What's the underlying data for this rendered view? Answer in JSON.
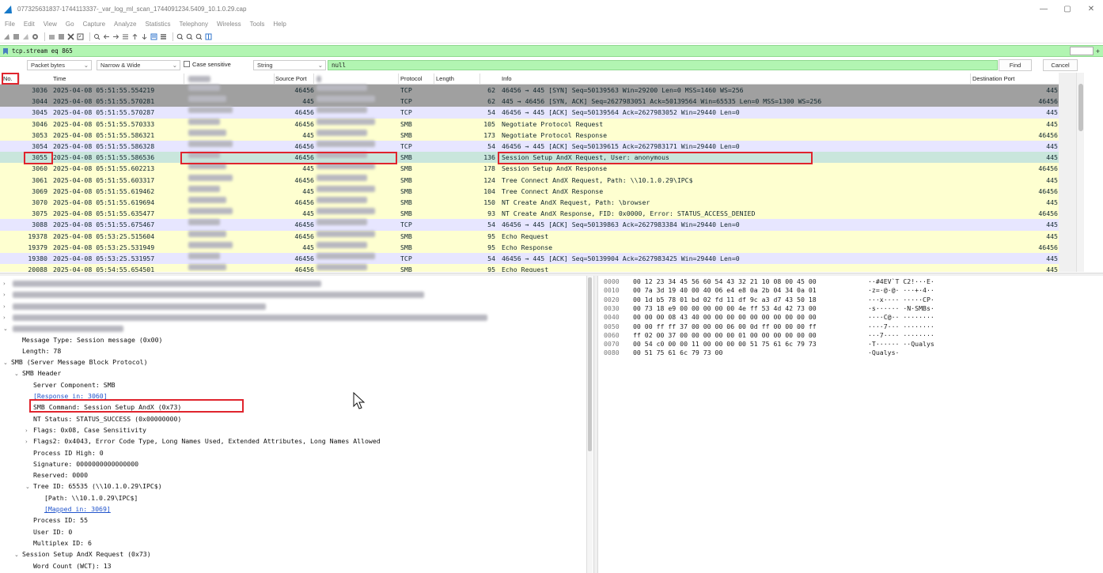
{
  "window": {
    "title": "077325631837-1744113337-_var_log_ml_scan_1744091234.5409_10.1.0.29.cap",
    "controls": [
      "—",
      "▢",
      "✕"
    ]
  },
  "menu": [
    "File",
    "Edit",
    "View",
    "Go",
    "Capture",
    "Analyze",
    "Statistics",
    "Telephony",
    "Wireless",
    "Tools",
    "Help"
  ],
  "filter": {
    "value": "tcp.stream eq 865"
  },
  "find": {
    "search_in": "Packet bytes",
    "char_width": "Narrow & Wide",
    "case_sensitive_label": "Case sensitive",
    "search_type": "String",
    "value": "null",
    "find_label": "Find",
    "cancel_label": "Cancel"
  },
  "packet_list": {
    "columns": [
      "No.",
      "Time",
      "Source Port",
      "Protocol",
      "Length",
      "Info",
      "Destination Port"
    ],
    "rows": [
      {
        "no": "3036",
        "time": "2025-04-08 05:51:55.554219",
        "sport": "46456",
        "proto": "TCP",
        "len": "62",
        "info": "46456 → 445 [SYN] Seq=50139563 Win=29200 Len=0 MSS=1460 WS=256",
        "dport": "445",
        "bg": "#a0a0a0"
      },
      {
        "no": "3044",
        "time": "2025-04-08 05:51:55.570281",
        "sport": "445",
        "proto": "TCP",
        "len": "62",
        "info": "445 → 46456 [SYN, ACK] Seq=2627983051 Ack=50139564 Win=65535 Len=0 MSS=1300 WS=256",
        "dport": "46456",
        "bg": "#a0a0a0"
      },
      {
        "no": "3045",
        "time": "2025-04-08 05:51:55.570287",
        "sport": "46456",
        "proto": "TCP",
        "len": "54",
        "info": "46456 → 445 [ACK] Seq=50139564 Ack=2627983052 Win=29440 Len=0",
        "dport": "445",
        "bg": "#e7e6ff"
      },
      {
        "no": "3046",
        "time": "2025-04-08 05:51:55.570333",
        "sport": "46456",
        "proto": "SMB",
        "len": "105",
        "info": "Negotiate Protocol Request",
        "dport": "445",
        "bg": "#feffd0"
      },
      {
        "no": "3053",
        "time": "2025-04-08 05:51:55.586321",
        "sport": "445",
        "proto": "SMB",
        "len": "173",
        "info": "Negotiate Protocol Response",
        "dport": "46456",
        "bg": "#feffd0"
      },
      {
        "no": "3054",
        "time": "2025-04-08 05:51:55.586328",
        "sport": "46456",
        "proto": "TCP",
        "len": "54",
        "info": "46456 → 445 [ACK] Seq=50139615 Ack=2627983171 Win=29440 Len=0",
        "dport": "445",
        "bg": "#e7e6ff"
      },
      {
        "no": "3055",
        "time": "2025-04-08 05:51:55.586536",
        "sport": "46456",
        "proto": "SMB",
        "len": "136",
        "info": "Session Setup AndX Request, User: anonymous",
        "dport": "445",
        "bg": "#c9e6dc"
      },
      {
        "no": "3060",
        "time": "2025-04-08 05:51:55.602213",
        "sport": "445",
        "proto": "SMB",
        "len": "178",
        "info": "Session Setup AndX Response",
        "dport": "46456",
        "bg": "#feffd0"
      },
      {
        "no": "3061",
        "time": "2025-04-08 05:51:55.603317",
        "sport": "46456",
        "proto": "SMB",
        "len": "124",
        "info": "Tree Connect AndX Request, Path: \\\\10.1.0.29\\IPC$",
        "dport": "445",
        "bg": "#feffd0"
      },
      {
        "no": "3069",
        "time": "2025-04-08 05:51:55.619462",
        "sport": "445",
        "proto": "SMB",
        "len": "104",
        "info": "Tree Connect AndX Response",
        "dport": "46456",
        "bg": "#feffd0"
      },
      {
        "no": "3070",
        "time": "2025-04-08 05:51:55.619694",
        "sport": "46456",
        "proto": "SMB",
        "len": "150",
        "info": "NT Create AndX Request, Path: \\browser",
        "dport": "445",
        "bg": "#feffd0"
      },
      {
        "no": "3075",
        "time": "2025-04-08 05:51:55.635477",
        "sport": "445",
        "proto": "SMB",
        "len": "93",
        "info": "NT Create AndX Response, FID: 0x0000, Error: STATUS_ACCESS_DENIED",
        "dport": "46456",
        "bg": "#feffd0"
      },
      {
        "no": "3088",
        "time": "2025-04-08 05:51:55.675467",
        "sport": "46456",
        "proto": "TCP",
        "len": "54",
        "info": "46456 → 445 [ACK] Seq=50139863 Ack=2627983384 Win=29440 Len=0",
        "dport": "445",
        "bg": "#e7e6ff"
      },
      {
        "no": "19378",
        "time": "2025-04-08 05:53:25.515604",
        "sport": "46456",
        "proto": "SMB",
        "len": "95",
        "info": "Echo Request",
        "dport": "445",
        "bg": "#feffd0"
      },
      {
        "no": "19379",
        "time": "2025-04-08 05:53:25.531949",
        "sport": "445",
        "proto": "SMB",
        "len": "95",
        "info": "Echo Response",
        "dport": "46456",
        "bg": "#feffd0"
      },
      {
        "no": "19380",
        "time": "2025-04-08 05:53:25.531957",
        "sport": "46456",
        "proto": "TCP",
        "len": "54",
        "info": "46456 → 445 [ACK] Seq=50139904 Ack=2627983425 Win=29440 Len=0",
        "dport": "445",
        "bg": "#e7e6ff"
      },
      {
        "no": "20088",
        "time": "2025-04-08 05:54:55.654501",
        "sport": "46456",
        "proto": "SMB",
        "len": "95",
        "info": "Echo Request",
        "dport": "445",
        "bg": "#feffd0"
      }
    ]
  },
  "details": [
    {
      "arrow": ">",
      "text": "",
      "blurred": true,
      "indent": 0
    },
    {
      "arrow": ">",
      "text": "",
      "blurred": true,
      "indent": 0
    },
    {
      "arrow": ">",
      "text": "",
      "blurred": true,
      "indent": 0
    },
    {
      "arrow": ">",
      "text": "",
      "blurred": true,
      "indent": 0
    },
    {
      "arrow": "v",
      "text": "",
      "blurred": true,
      "indent": 0
    },
    {
      "arrow": "",
      "text": "Message Type: Session message (0x00)",
      "indent": 1
    },
    {
      "arrow": "",
      "text": "Length: 78",
      "indent": 1
    },
    {
      "arrow": "v",
      "text": "SMB (Server Message Block Protocol)",
      "indent": 0
    },
    {
      "arrow": "v",
      "text": "SMB Header",
      "indent": 1
    },
    {
      "arrow": "",
      "text": "Server Component: SMB",
      "indent": 2
    },
    {
      "arrow": "",
      "text": "[Response in: 3060]",
      "indent": 2,
      "link": true
    },
    {
      "arrow": "",
      "text": "SMB Command: Session Setup AndX (0x73)",
      "indent": 2
    },
    {
      "arrow": "",
      "text": "NT Status: STATUS_SUCCESS (0x00000000)",
      "indent": 2
    },
    {
      "arrow": ">",
      "text": "Flags: 0x08, Case Sensitivity",
      "indent": 2
    },
    {
      "arrow": ">",
      "text": "Flags2: 0x4043, Error Code Type, Long Names Used, Extended Attributes, Long Names Allowed",
      "indent": 2
    },
    {
      "arrow": "",
      "text": "Process ID High: 0",
      "indent": 2
    },
    {
      "arrow": "",
      "text": "Signature: 0000000000000000",
      "indent": 2
    },
    {
      "arrow": "",
      "text": "Reserved: 0000",
      "indent": 2
    },
    {
      "arrow": "v",
      "text": "Tree ID: 65535  (\\\\10.1.0.29\\IPC$)",
      "indent": 2
    },
    {
      "arrow": "",
      "text": "[Path: \\\\10.1.0.29\\IPC$]",
      "indent": 3
    },
    {
      "arrow": "",
      "text": "[Mapped in: 3069]",
      "indent": 3,
      "link": true
    },
    {
      "arrow": "",
      "text": "Process ID: 55",
      "indent": 2
    },
    {
      "arrow": "",
      "text": "User ID: 0",
      "indent": 2
    },
    {
      "arrow": "",
      "text": "Multiplex ID: 6",
      "indent": 2
    },
    {
      "arrow": "v",
      "text": "Session Setup AndX Request (0x73)",
      "indent": 1
    },
    {
      "arrow": "",
      "text": "Word Count (WCT): 13",
      "indent": 2
    }
  ],
  "bytes": [
    {
      "off": "0000",
      "hex": "00 12 23 34 45 56 60 54  43 32 21 10 08 00 45 00",
      "asc": "··#4EV`T C2!···E·"
    },
    {
      "off": "0010",
      "hex": "00 7a 3d 19 40 00 40 06  e4 e8 0a 2b 04 34 0a 01",
      "asc": "·z=·@·@· ···+·4··"
    },
    {
      "off": "0020",
      "hex": "00 1d b5 78 01 bd 02 fd  11 df 9c a3 d7 43 50 18",
      "asc": "···x···· ·····CP·"
    },
    {
      "off": "0030",
      "hex": "00 73 18 e9 00 00 00 00  00 4e ff 53 4d 42 73 00",
      "asc": "·s······ ·N·SMBs·"
    },
    {
      "off": "0040",
      "hex": "00 00 00 08 43 40 00 00  00 00 00 00 00 00 00 00",
      "asc": "····C@·· ········"
    },
    {
      "off": "0050",
      "hex": "00 00 ff ff 37 00 00 00  06 00 0d ff 00 00 00 ff",
      "asc": "····7··· ········"
    },
    {
      "off": "0060",
      "hex": "ff 02 00 37 00 00 00 00  00 01 00 00 00 00 00 00",
      "asc": "···7···· ········"
    },
    {
      "off": "0070",
      "hex": "00 54 c0 00 00 11 00 00  00 00 51 75 61 6c 79 73",
      "asc": "·T······ ··Qualys"
    },
    {
      "off": "0080",
      "hex": "00 51 75 61 6c 79 73 00",
      "asc": "·Qualys·"
    }
  ],
  "colors": {
    "filter_green": "#b2f5b2",
    "highlight_red": "#e0242d",
    "selected_row": "#c9e6dc",
    "smb_row": "#feffd0",
    "tcp_row": "#e7e6ff",
    "syn_row": "#a0a0a0"
  },
  "icons": {
    "app": "wireshark-fin-icon",
    "filter": "bookmark-icon"
  }
}
